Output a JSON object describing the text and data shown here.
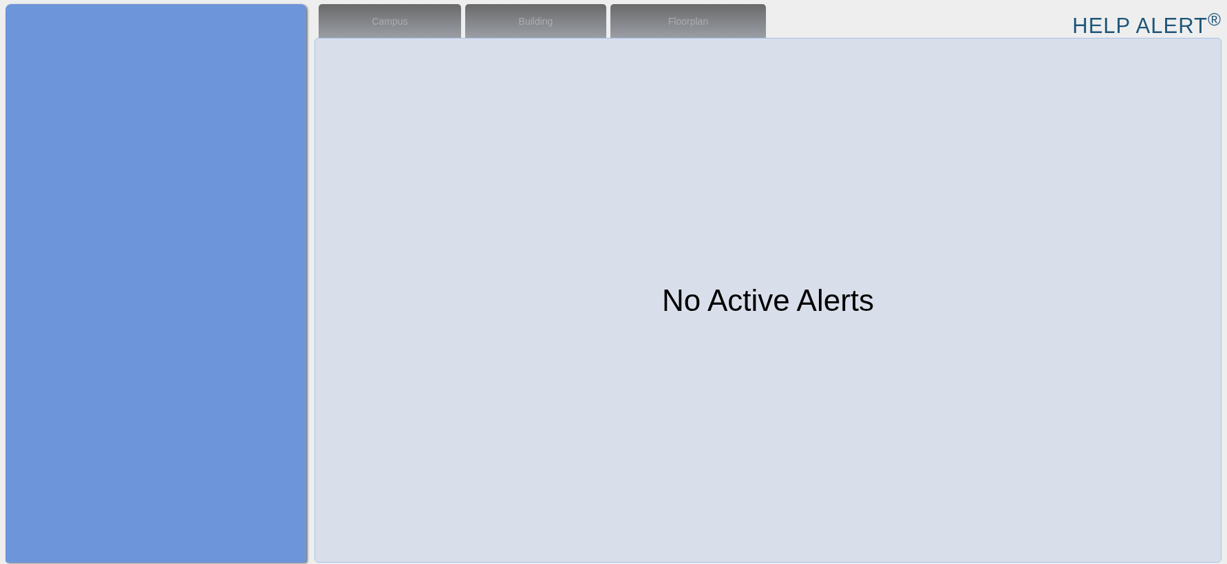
{
  "tabs": [
    {
      "label": "Campus"
    },
    {
      "label": "Building"
    },
    {
      "label": "Floorplan"
    }
  ],
  "logo": {
    "text": "HELP ALERT$^{®}$"
  },
  "main": {
    "message": "No Active Alerts"
  }
}
